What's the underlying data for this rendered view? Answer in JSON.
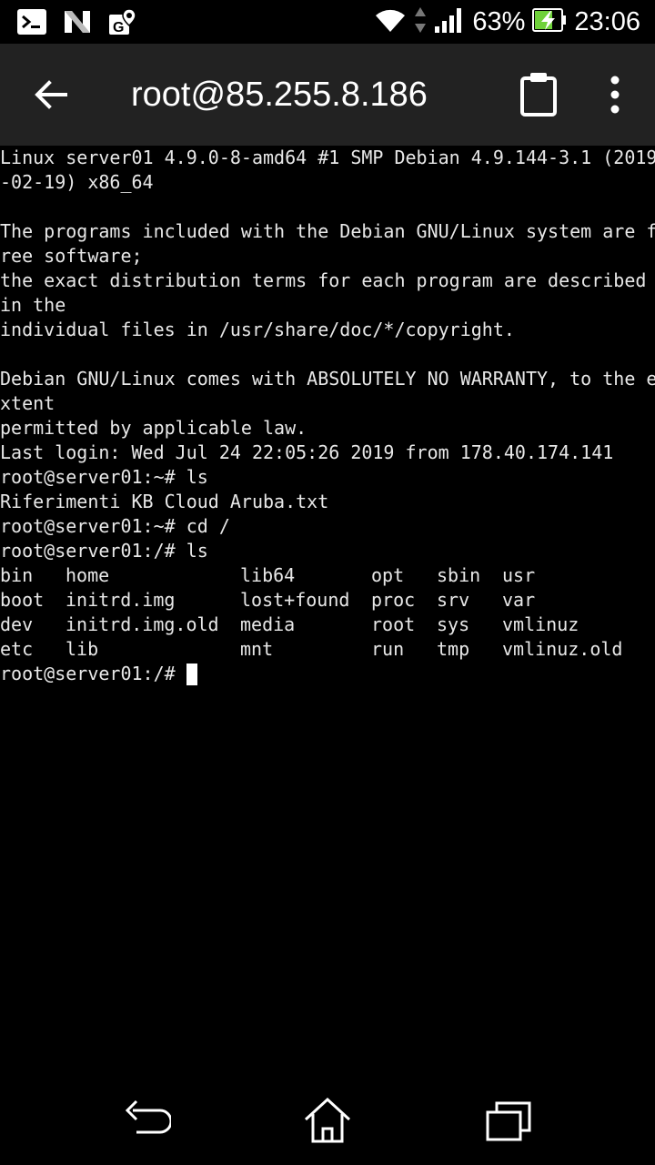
{
  "status_bar": {
    "battery_percent": "63%",
    "time": "23:06",
    "icons": [
      "terminal-icon",
      "n-icon",
      "maps-icon",
      "wifi-icon",
      "data-arrows-icon",
      "signal-icon",
      "battery-charging-icon"
    ]
  },
  "app_bar": {
    "title": "root@85.255.8.186",
    "back_icon": "arrow-back-icon",
    "clipboard_icon": "clipboard-icon",
    "more_icon": "more-vert-icon"
  },
  "terminal": {
    "lines": [
      "Linux server01 4.9.0-8-amd64 #1 SMP Debian 4.9.144-3.1 (2019",
      "-02-19) x86_64",
      "",
      "The programs included with the Debian GNU/Linux system are f",
      "ree software;",
      "the exact distribution terms for each program are described ",
      "in the",
      "individual files in /usr/share/doc/*/copyright.",
      "",
      "Debian GNU/Linux comes with ABSOLUTELY NO WARRANTY, to the e",
      "xtent",
      "permitted by applicable law.",
      "Last login: Wed Jul 24 22:05:26 2019 from 178.40.174.141",
      "root@server01:~# ls",
      "Riferimenti KB Cloud Aruba.txt",
      "root@server01:~# cd /",
      "root@server01:/# ls"
    ],
    "ls_rows": [
      [
        "bin",
        "home",
        "lib64",
        "opt",
        "sbin",
        "usr"
      ],
      [
        "boot",
        "initrd.img",
        "lost+found",
        "proc",
        "srv",
        "var"
      ],
      [
        "dev",
        "initrd.img.old",
        "media",
        "root",
        "sys",
        "vmlinuz"
      ],
      [
        "etc",
        "lib",
        "mnt",
        "run",
        "tmp",
        "vmlinuz.old"
      ]
    ],
    "prompt": "root@server01:/# "
  },
  "nav_bar": {
    "icons": [
      "back-nav-icon",
      "home-icon",
      "recents-icon"
    ]
  },
  "colors": {
    "background": "#000000",
    "appbar": "#222222",
    "text": "#e8e8e8",
    "battery_charging": "#6fd13a"
  }
}
